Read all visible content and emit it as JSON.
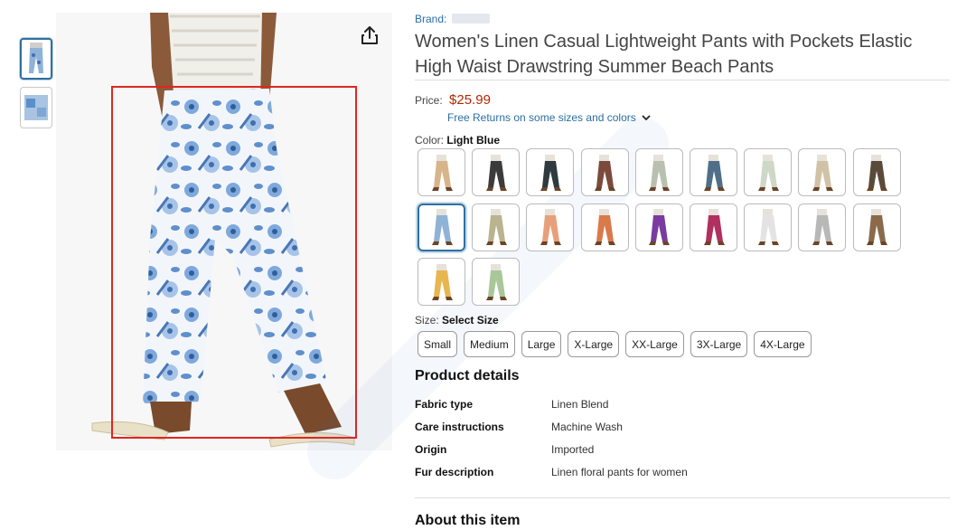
{
  "brand": {
    "prefix": "Brand:"
  },
  "product": {
    "title": "Women's Linen Casual Lightweight Pants with Pockets Elastic High Waist Drawstring Summer Beach Pants",
    "price_label": "Price:",
    "price": "$25.99",
    "returns": "Free Returns on some sizes and colors"
  },
  "color": {
    "label": "Color:",
    "selected": "Light Blue"
  },
  "swatch_colors": [
    "#d8b48a",
    "#3b3b3b",
    "#2f3a3f",
    "#7b4a3c",
    "#b9c0b0",
    "#4f6f88",
    "#cfd8c7",
    "#cfc2a6",
    "#5a4a3a",
    "#8fb3d6",
    "#b9b38f",
    "#e8a07a",
    "#d97a4a",
    "#7a3aa0",
    "#b03060",
    "#e3e3e3",
    "#b8b8b8",
    "#8a6a4a",
    "#e8b64f",
    "#a9c79a"
  ],
  "size": {
    "label": "Size:",
    "selected": "Select Size",
    "options": [
      "Small",
      "Medium",
      "Large",
      "X-Large",
      "XX-Large",
      "3X-Large",
      "4X-Large"
    ]
  },
  "details": {
    "title": "Product details",
    "rows": [
      {
        "key": "Fabric type",
        "value": "Linen Blend"
      },
      {
        "key": "Care instructions",
        "value": "Machine Wash"
      },
      {
        "key": "Origin",
        "value": "Imported"
      },
      {
        "key": "Fur description",
        "value": "Linen floral pants for women"
      }
    ]
  },
  "about": {
    "title": "About this item"
  },
  "icons": {
    "share": "share-icon",
    "chevron": "chevron-down-icon"
  },
  "colors": {
    "link": "#2b6ea3",
    "price": "#B12704",
    "highlight_box": "#e0261f",
    "pants_print": "#5b8fc9"
  }
}
